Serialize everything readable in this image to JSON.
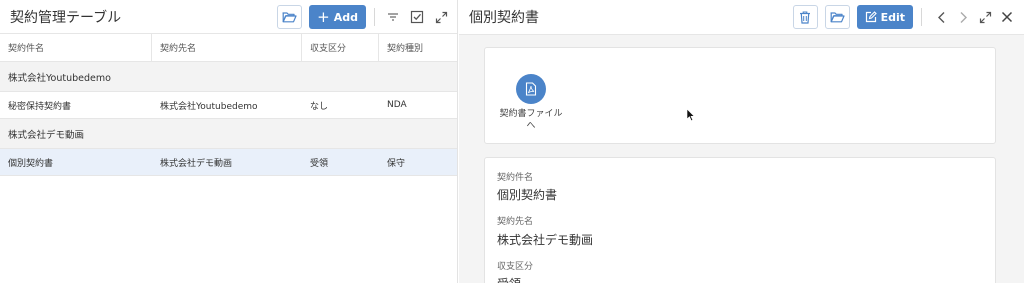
{
  "left_panel": {
    "title": "契約管理テーブル",
    "add_label": "Add",
    "columns": [
      "契約件名",
      "契約先名",
      "収支区分",
      "契約種別"
    ],
    "groups": [
      {
        "name": "株式会社Youtubedemo",
        "rows": [
          [
            "秘密保持契約書",
            "株式会社Youtubedemo",
            "なし",
            "NDA"
          ]
        ]
      },
      {
        "name": "株式会社デモ動画",
        "rows": [
          [
            "個別契約書",
            "株式会社デモ動画",
            "受領",
            "保守"
          ]
        ]
      }
    ]
  },
  "right_panel": {
    "title": "個別契約書",
    "edit_label": "Edit",
    "file_button_label": "契約書ファイルへ",
    "fields": [
      {
        "label": "契約件名",
        "value": "個別契約書"
      },
      {
        "label": "契約先名",
        "value": "株式会社デモ動画"
      },
      {
        "label": "収支区分",
        "value": "受領"
      }
    ]
  },
  "icons": {
    "folder": "folder-open-icon",
    "plus": "plus-icon",
    "filter": "filter-icon",
    "checkbox": "checkbox-icon",
    "expand": "expand-icon",
    "trash": "trash-icon",
    "edit": "edit-icon",
    "prev": "chevron-left-icon",
    "next": "chevron-right-icon",
    "close": "close-icon",
    "pdf": "pdf-file-icon"
  },
  "colors": {
    "accent": "#4b84c9",
    "selected_row": "#e9f0fa",
    "group_bg": "#f3f3f3"
  }
}
